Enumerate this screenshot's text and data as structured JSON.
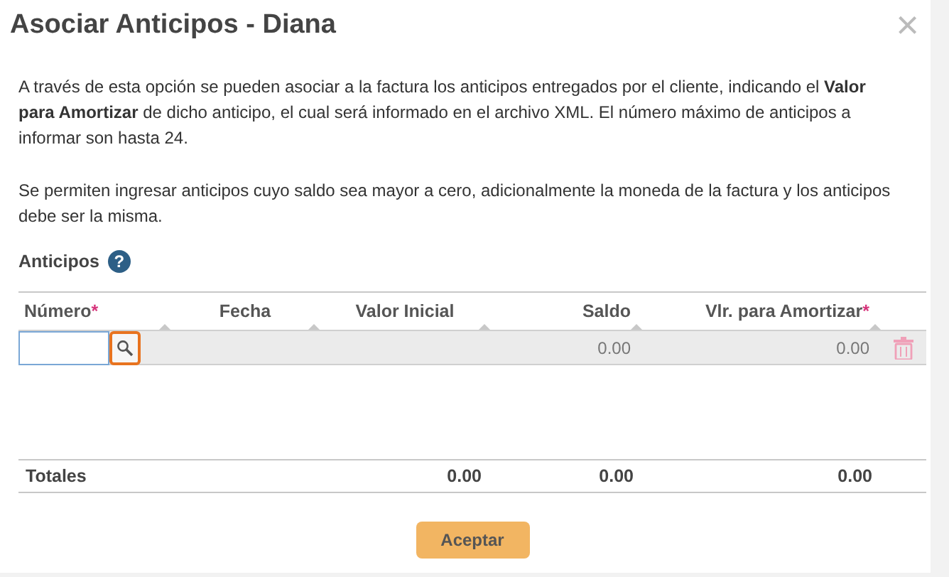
{
  "dialog": {
    "title": "Asociar Anticipos - Diana",
    "close": "×"
  },
  "description": [
    "A través de esta opción se pueden asociar a la factura los anticipos entregados por el cliente, indicando el **Valor para Amortizar** de dicho anticipo, el cual será informado en el archivo XML. El número máximo de anticipos a informar son hasta 24.",
    "Se permiten ingresar anticipos cuyo saldo sea mayor a cero, adicionalmente la moneda de la factura y los anticipos debe ser la misma."
  ],
  "section": {
    "label": "Anticipos",
    "help": "?"
  },
  "table": {
    "columns": [
      {
        "label": "Número",
        "required_mark": "*"
      },
      {
        "label": "Fecha"
      },
      {
        "label": "Valor Inicial"
      },
      {
        "label": "Saldo"
      },
      {
        "label": "Vlr. para Amortizar",
        "required_mark": "*"
      }
    ],
    "rows": [
      {
        "saldo": "0.00",
        "amortizar": "0.00"
      }
    ],
    "totals": {
      "label": "Totales",
      "valor_inicial": "0.00",
      "saldo": "0.00",
      "amortizar": "0.00"
    }
  },
  "buttons": [
    "Aceptar"
  ]
}
